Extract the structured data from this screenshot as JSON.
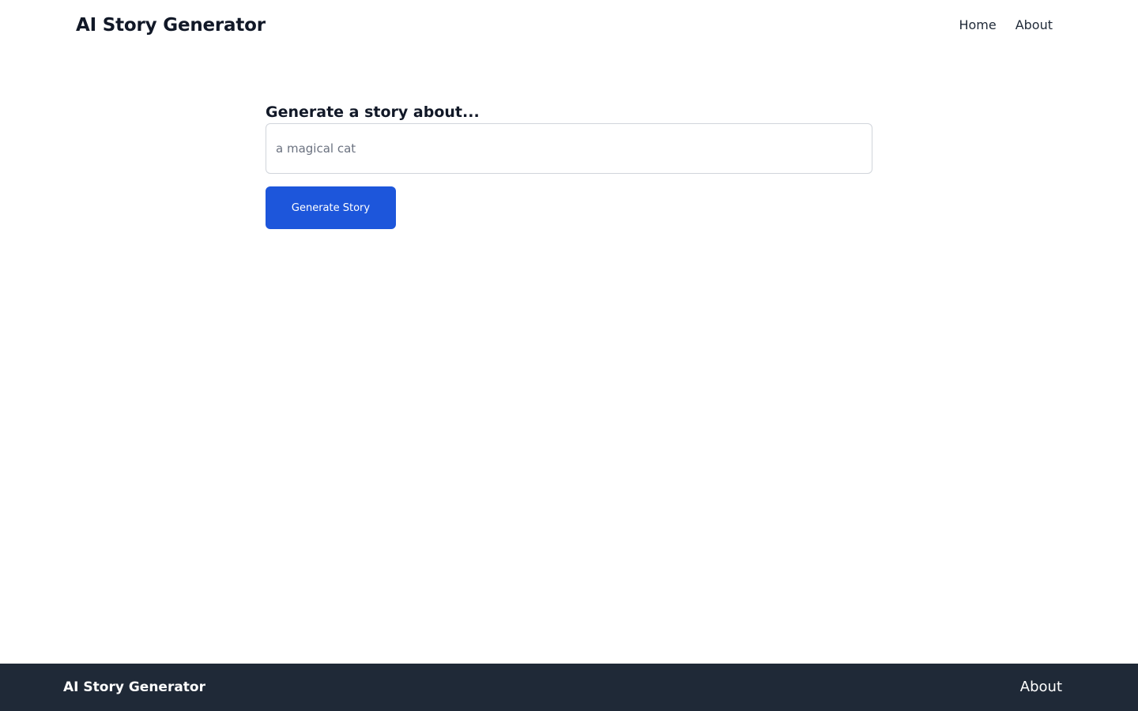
{
  "header": {
    "brand": "AI Story Generator",
    "nav": [
      {
        "label": "Home"
      },
      {
        "label": "About"
      }
    ]
  },
  "main": {
    "prompt_label": "Generate a story about...",
    "input": {
      "value": "",
      "placeholder": "a magical cat"
    },
    "generate_button": "Generate Story"
  },
  "footer": {
    "brand": "AI Story Generator",
    "about_link": "About"
  },
  "colors": {
    "primary_button": "#1d56db",
    "footer_background": "#1f2937",
    "text_dark": "#111827"
  }
}
